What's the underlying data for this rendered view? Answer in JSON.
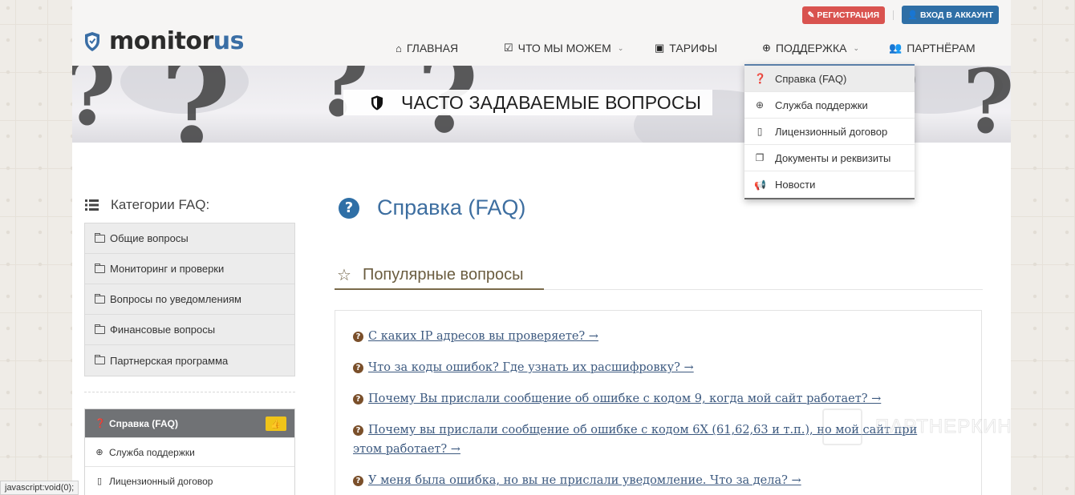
{
  "header": {
    "logo": {
      "part1": "monitor",
      "part2": "us"
    },
    "register_label": "РЕГИСТРАЦИЯ",
    "login_label": "ВХОД В АККАУНТ"
  },
  "nav": [
    {
      "label": "ГЛАВНАЯ",
      "icon": "home-icon"
    },
    {
      "label": "ЧТО МЫ МОЖЕМ",
      "icon": "check-square-icon"
    },
    {
      "label": "ТАРИФЫ",
      "icon": "money-icon"
    },
    {
      "label": "ПОДДЕРЖКА",
      "icon": "lifebuoy-icon"
    },
    {
      "label": "ПАРТНЁРАМ",
      "icon": "users-icon"
    }
  ],
  "dropdown": [
    {
      "label": "Справка (FAQ)",
      "icon": "question-circle-icon"
    },
    {
      "label": "Служба поддержки",
      "icon": "lifebuoy-icon"
    },
    {
      "label": "Лицензионный договор",
      "icon": "file-icon"
    },
    {
      "label": "Документы и реквизиты",
      "icon": "copy-icon"
    },
    {
      "label": "Новости",
      "icon": "bullhorn-icon"
    }
  ],
  "banner": {
    "title": "ЧАСТО ЗАДАВАЕМЫЕ ВОПРОСЫ"
  },
  "sidebar": {
    "title": "Категории FAQ:",
    "categories": [
      "Общие вопросы",
      "Мониторинг и проверки",
      "Вопросы по уведомлениям",
      "Финансовые вопросы",
      "Партнерская программа"
    ],
    "sub_items": [
      {
        "label": "Справка (FAQ)"
      },
      {
        "label": "Служба поддержки"
      },
      {
        "label": "Лицензионный договор"
      }
    ]
  },
  "main": {
    "title": "Справка (FAQ)",
    "popular_label": "Популярные вопросы",
    "faq": [
      {
        "text": "С каких IP адресов вы проверяете? →"
      },
      {
        "text": "Что за коды ошибок? Где узнать их расшифровку? →"
      },
      {
        "text": "Почему Вы прислали сообщение об ошибке с кодом 9, когда мой сайт работает? →"
      },
      {
        "text": "Почему вы прислали сообщение об ошибке с кодом 6X (61,62,63 и т.п.), но мой сайт при этом работает? →"
      },
      {
        "text": "У меня была ошибка, но вы не прислали уведомление. Что за дела? →"
      }
    ]
  },
  "watermark": "ПАРТНЕРКИН",
  "statusbar": "javascript:void(0);",
  "colors": {
    "accent": "#2f6fa6",
    "register": "#d9534f",
    "heading": "#3d6ea0",
    "popular": "#6b5d40"
  }
}
